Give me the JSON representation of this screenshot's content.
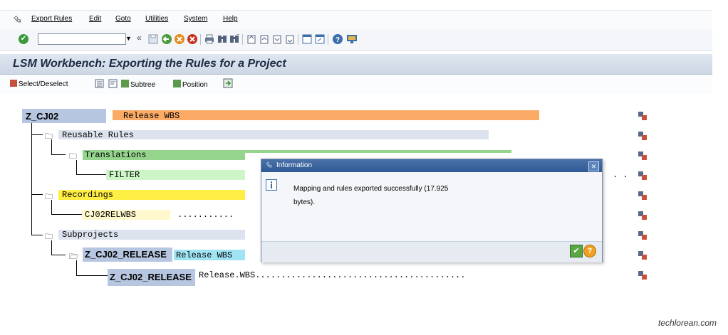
{
  "menu": {
    "items": [
      "Export Rules",
      "Edit",
      "Goto",
      "Utilities",
      "System",
      "Help"
    ]
  },
  "toolbar": {
    "command_value": "",
    "icons": [
      "enter-icon",
      "back-icon",
      "save-icon",
      "exit-icon",
      "cancel-icon",
      "print-icon",
      "find-icon",
      "find-next-icon",
      "first-page-icon",
      "prev-page-icon",
      "next-page-icon",
      "last-page-icon",
      "create-session-icon",
      "shortcut-icon",
      "help-icon",
      "layout-icon"
    ]
  },
  "title": "LSM Workbench: Exporting the Rules for a Project",
  "app_toolbar": {
    "select_deselect": "Select/Deselect",
    "subtree": "Subtree",
    "position": "Position"
  },
  "tree": {
    "root": {
      "code": "Z_CJ02",
      "desc": "Release WBS"
    },
    "reusable_rules": "Reusable Rules",
    "translations": "Translations",
    "filter": "FILTER",
    "recordings": "Recordings",
    "recording_item": "CJ02RELWBS",
    "recording_dots": "...........",
    "subprojects": "Subprojects",
    "sub_code": "Z_CJ02_RELEASE",
    "sub_desc": "Release WBS",
    "leaf_code": "Z_CJ02_RELEASE",
    "leaf_desc": "Release.WBS.........................................",
    "filter_trail": ". ."
  },
  "dialog": {
    "title": "Information",
    "message": "Mapping and rules exported successfully (17.925 bytes)."
  },
  "credit": "techlorean.com",
  "colors": {
    "root_bg": "#b7c6e0",
    "orange": "#fbab66",
    "green": "#94d48c",
    "light_green": "#cdf5c8",
    "yellow": "#ffee44",
    "light_yellow": "#fff8cc",
    "cyan": "#a0e4f4",
    "gray_bar": "#dde3ee"
  }
}
